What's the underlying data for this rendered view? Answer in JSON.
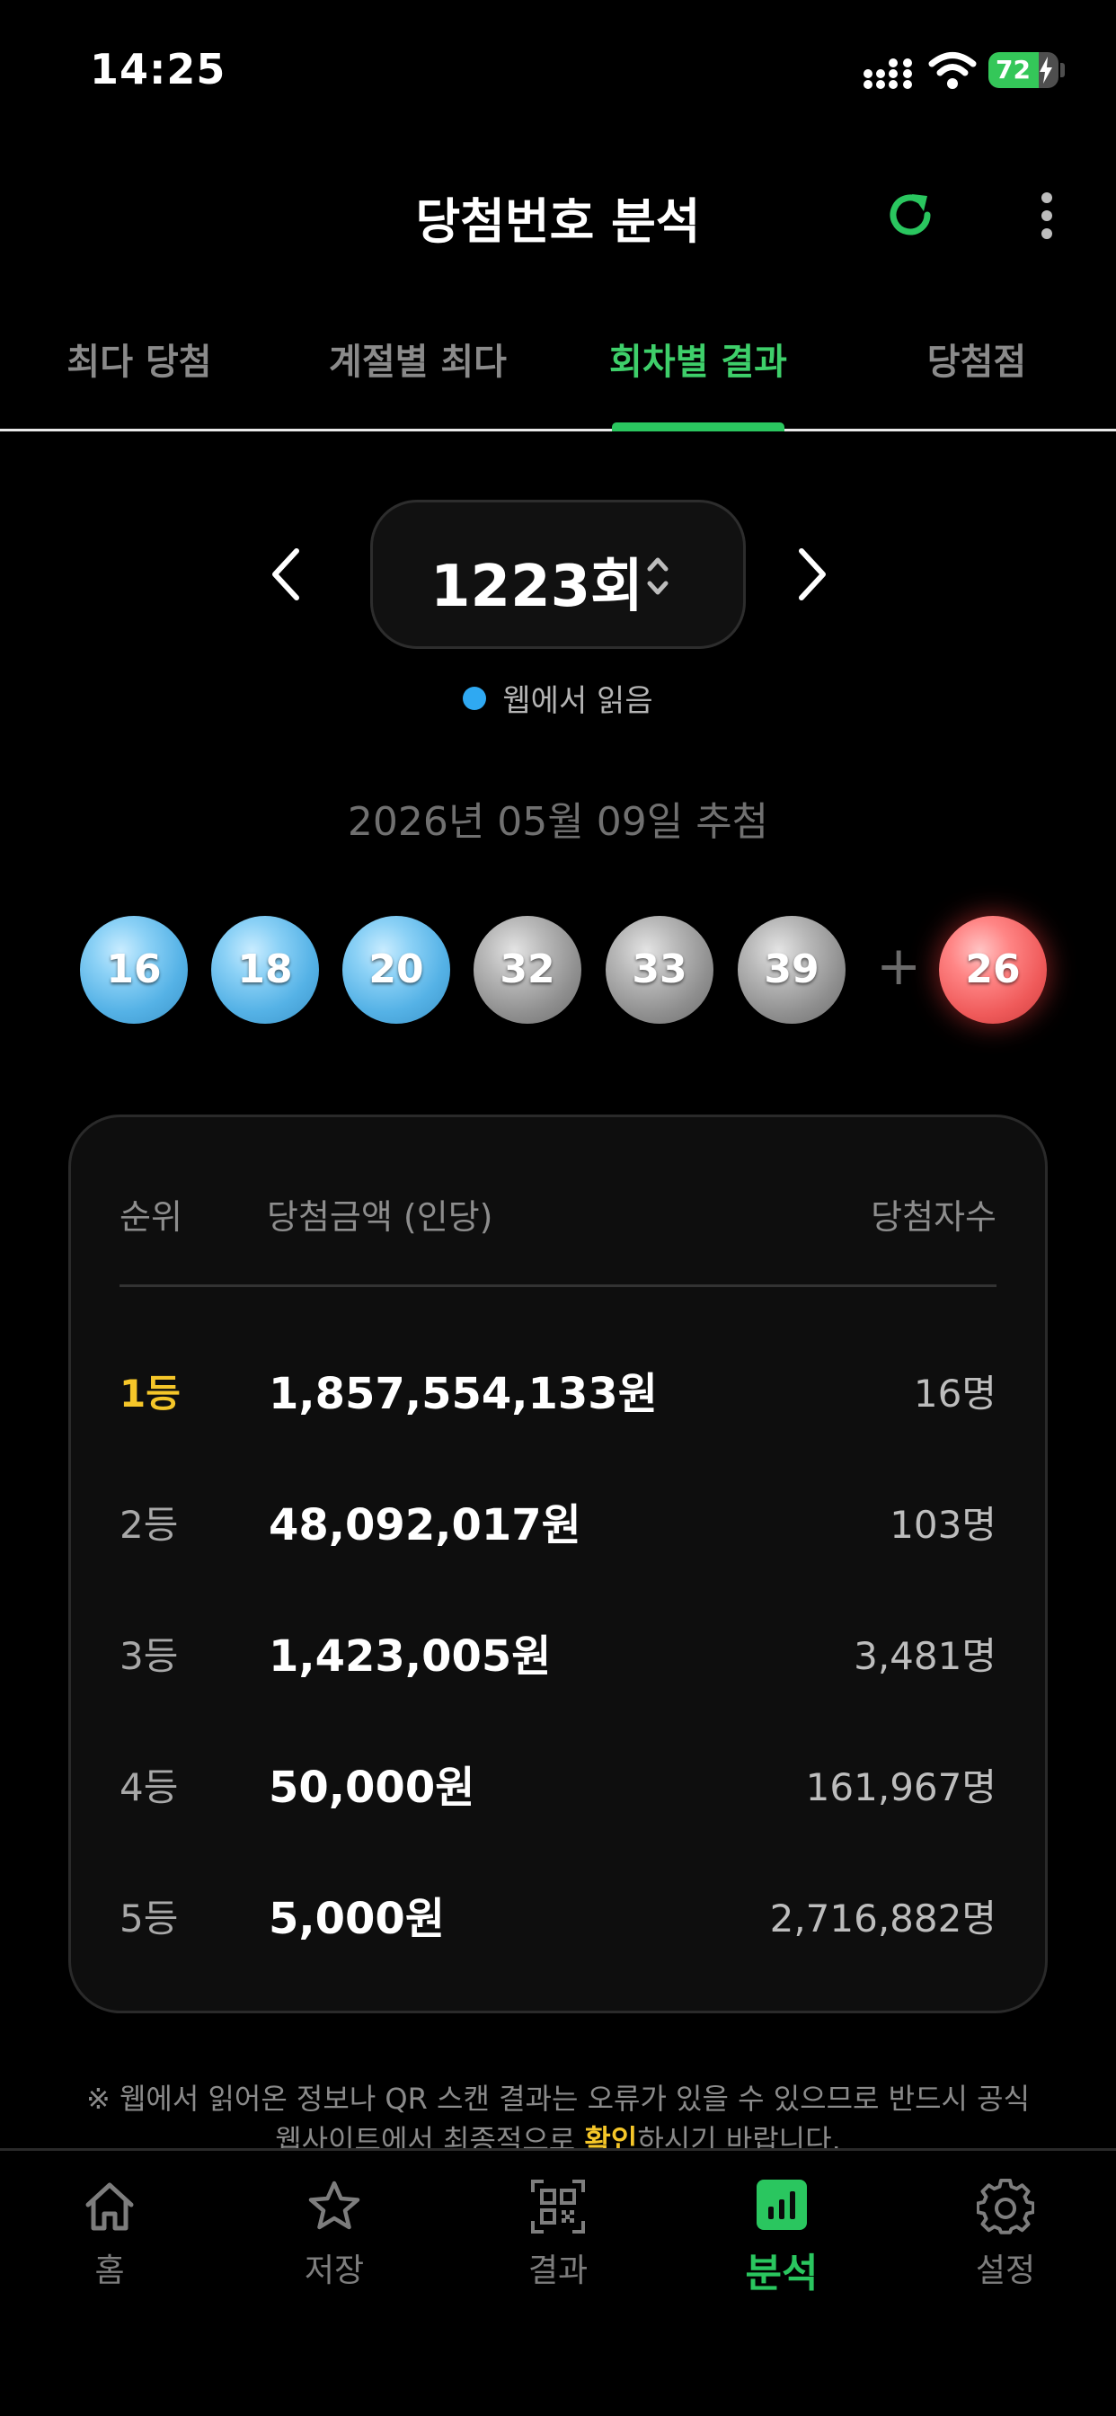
{
  "status_bar": {
    "time": "14:25",
    "battery_percent": 72,
    "battery_text": "72"
  },
  "header": {
    "title": "당첨번호 분석",
    "refresh_icon": "refresh-icon",
    "more_icon": "more-vertical-icon"
  },
  "tabs": [
    {
      "label": "최다 당첨",
      "active": false
    },
    {
      "label": "계절별 최다",
      "active": false
    },
    {
      "label": "회차별 결과",
      "active": true
    },
    {
      "label": "당첨점",
      "active": false
    }
  ],
  "round": {
    "label": "1223회",
    "source": "웹에서 읽음",
    "draw_date": "2026년 05월 09일 추첨"
  },
  "numbers": {
    "main": [
      {
        "value": "16",
        "color": "blue"
      },
      {
        "value": "18",
        "color": "blue"
      },
      {
        "value": "20",
        "color": "blue"
      },
      {
        "value": "32",
        "color": "gray"
      },
      {
        "value": "33",
        "color": "gray"
      },
      {
        "value": "39",
        "color": "gray"
      }
    ],
    "plus": "+",
    "bonus": {
      "value": "26",
      "color": "red"
    }
  },
  "prize_table": {
    "headers": {
      "rank": "순위",
      "amount": "당첨금액 (인당)",
      "winners": "당첨자수"
    },
    "rows": [
      {
        "rank": "1등",
        "amount": "1,857,554,133원",
        "winners": "16명"
      },
      {
        "rank": "2등",
        "amount": "48,092,017원",
        "winners": "103명"
      },
      {
        "rank": "3등",
        "amount": "1,423,005원",
        "winners": "3,481명"
      },
      {
        "rank": "4등",
        "amount": "50,000원",
        "winners": "161,967명"
      },
      {
        "rank": "5등",
        "amount": "5,000원",
        "winners": "2,716,882명"
      }
    ]
  },
  "disclaimer": {
    "line1": "※ 웹에서 읽어온 정보나 QR 스캔 결과는 오류가 있을 수 있으므로 반드시 공식",
    "line2_before": "웹사이트에서 최종적으로 ",
    "line2_highlight": "확인",
    "line2_after": "하시기 바랍니다."
  },
  "bottom_nav": [
    {
      "label": "홈",
      "icon": "home-icon",
      "active": false
    },
    {
      "label": "저장",
      "icon": "star-icon",
      "active": false
    },
    {
      "label": "결과",
      "icon": "qr-code-icon",
      "active": false
    },
    {
      "label": "분석",
      "icon": "bar-chart-icon",
      "active": true
    },
    {
      "label": "설정",
      "icon": "gear-icon",
      "active": false
    }
  ],
  "colors": {
    "accent": "#2ac65f",
    "first_prize": "#f5c629",
    "source_dot": "#2fa9f2"
  }
}
